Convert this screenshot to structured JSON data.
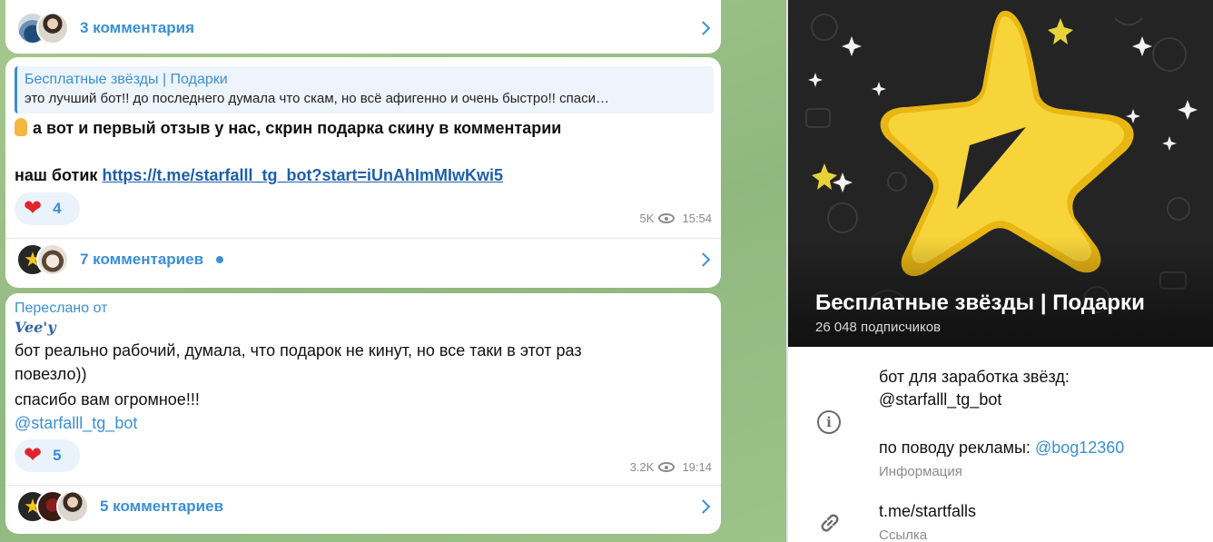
{
  "post1": {
    "comments_label": "3 комментария"
  },
  "post2": {
    "reply_author": "Бесплатные звёзды | Подарки",
    "reply_text": "это лучший бот!! до последнего думала что скам, но всё афигенно и очень быстро!! спаси…",
    "line1": "а вот и первый отзыв у нас, скрин подарка скину в комментарии",
    "line2_prefix": "наш ботик ",
    "link": "https://t.me/starfalll_tg_bot?start=iUnAhImMIwKwi5",
    "reaction_count": "4",
    "views": "5K",
    "time": "15:54",
    "comments_label": "7 комментариев"
  },
  "post3": {
    "forwarded_label": "Переслано от",
    "forwarded_name": "Vee'y",
    "text_line1": "бот реально рабочий, думала, что подарок не кинут, но все таки в этот раз",
    "text_line2": "повезло))",
    "text_line3": "спасибо вам огромное!!!",
    "mention": "@starfalll_tg_bot",
    "reaction_count": "5",
    "views": "3.2K",
    "time": "19:14",
    "comments_label": "5 комментариев"
  },
  "channel": {
    "title": "Бесплатные звёзды | Подарки",
    "subscribers": "26 048 подписчиков",
    "desc_line1": "бот для заработка звёзд:",
    "desc_mention": "@starfalll_tg_bot",
    "ads_prefix": "по поводу рекламы: ",
    "ads_mention": "@bog12360",
    "info_label": "Информация",
    "link": "t.me/startfalls",
    "link_label": "Ссылка"
  },
  "colors": {
    "accent": "#3a8fd6",
    "chat_background": "#9cc08a",
    "heart": "#e0242c",
    "star": "#f7c617"
  },
  "icons": [
    "chevron-right-icon",
    "heart-icon",
    "eye-icon",
    "info-icon",
    "link-icon",
    "star-icon",
    "pointing-finger-emoji"
  ]
}
